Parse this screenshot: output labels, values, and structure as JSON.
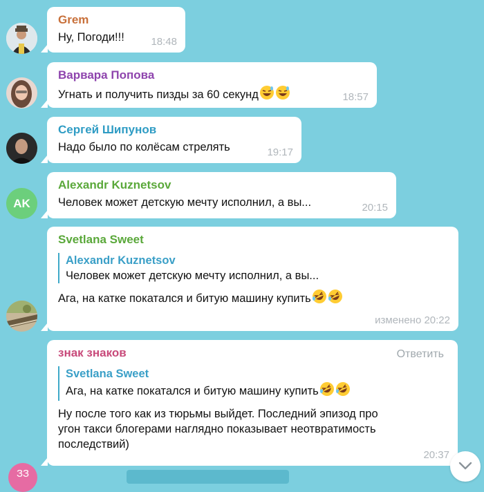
{
  "messages": [
    {
      "author": "Grem",
      "author_color": "#c8703a",
      "text": "Ну, Погоди!!!",
      "time": "18:48",
      "avatar": "photo"
    },
    {
      "author": "Варвара Попова",
      "author_color": "#8e44ad",
      "text": "Угнать и получить пизды за 60 секунд",
      "emojis": 2,
      "emoji": "grinning-sweat",
      "time": "18:57",
      "avatar": "photo"
    },
    {
      "author": "Сергей Шипунов",
      "author_color": "#2f9cc4",
      "text": "Надо было по колёсам стрелять",
      "time": "19:17",
      "avatar": "photo"
    },
    {
      "author": "Alexandr Kuznetsov",
      "author_color": "#5aa83a",
      "text": "Человек может детскую мечту исполнил, а вы...",
      "time": "20:15",
      "avatar_initials": "AK",
      "avatar_color": "#6ccf7c"
    },
    {
      "author": "Svetlana Sweet",
      "author_color": "#5aa83a",
      "quote_author": "Alexandr Kuznetsov",
      "quote_text": "Человек может детскую мечту исполнил, а вы...",
      "text": "Ага, на катке покатался и битую машину купить",
      "emojis": 2,
      "emoji": "rofl",
      "time": "изменено 20:22",
      "avatar": "photo"
    },
    {
      "author": "знак знаков",
      "author_color": "#c84a7a",
      "reply_label": "Ответить",
      "quote_author": "Svetlana Sweet",
      "quote_text": "Ага, на катке покатался и битую машину купить",
      "quote_emojis": 2,
      "text_lines": [
        "Ну после того как из тюрьмы выйдет. Последний эпизод про",
        "угон такси блогерами наглядно показывает неотвратимость",
        "последствий)"
      ],
      "time": "20:37"
    }
  ],
  "bottom_avatar_initials": "ЗЗ",
  "icons": {
    "scroll_down": "chevron-down-icon"
  }
}
